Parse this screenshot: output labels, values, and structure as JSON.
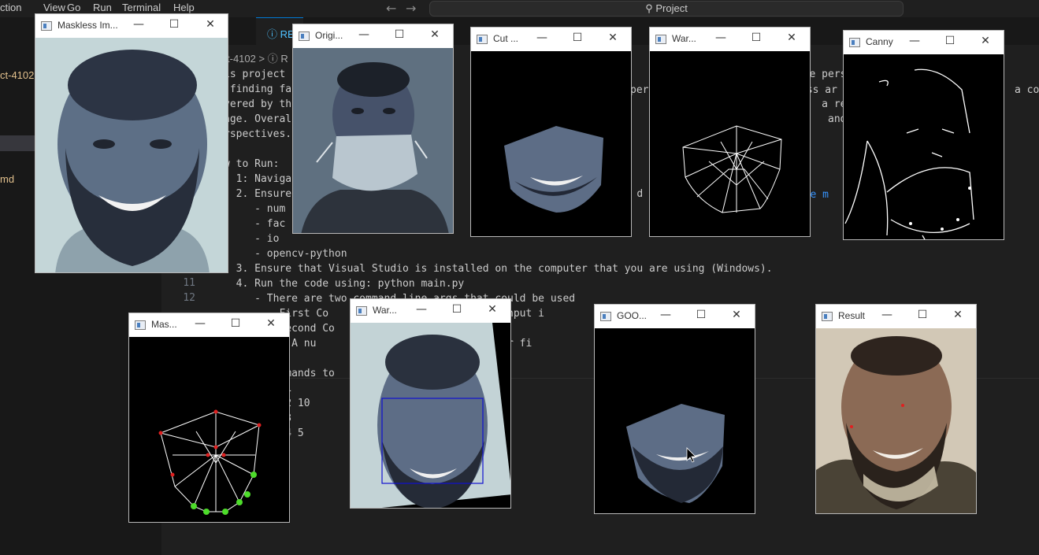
{
  "menu": [
    "ction",
    "View",
    "Go",
    "Run",
    "Terminal",
    "Help"
  ],
  "search": {
    "label": "Project"
  },
  "sidebar": {
    "items": [
      "ct-4102",
      "md"
    ]
  },
  "tab": {
    "label": "RE"
  },
  "breadcrumb": {
    "folder": "t-4102",
    "sep": ">",
    "file_start": "R"
  },
  "code_lines": [
    "is project              of                       val                    by tak                 e pers",
    " finding fa         's ",
    "vered by th         unap                     the                                 In the          a res",
    "age. Overal          to                      ever                                ld be            and w",
    "rspectives.",
    "",
    "w to Run:",
    "  1: Naviga",
    "  2. Ensure             pen                                        d (i",
    "     - num",
    "     - fac",
    "     - io",
    "     - opencv-python",
    "  3. Ensure that Visual Studio is installed on the computer that you are using (Windows).",
    "  4. Run the code using: python main.py",
    "     - There are two command line args that could be used",
    "       - First Co                    ges the input i                         s on",
    "       - Second Co",
    "         - A nu                    sholding for fi                     point (Man",
    "",
    "       commands to",
    "       py 1",
    "       py 2 10",
    "       py 3",
    "       py 4 5"
  ],
  "code_link": "kage m",
  "code_extra": "ess ar",
  "code_extra2": "a con",
  "code_extra3": "pers",
  "line_numbers": [
    "11",
    "12"
  ],
  "windows": [
    {
      "title": "Maskless Im...",
      "name": "maskless-image"
    },
    {
      "title": "Origi...",
      "name": "original-image"
    },
    {
      "title": "Cut ...",
      "name": "cut-face"
    },
    {
      "title": "War...",
      "name": "warped-mesh"
    },
    {
      "title": "Canny",
      "name": "canny"
    },
    {
      "title": "Mas...",
      "name": "mask-landmarks"
    },
    {
      "title": "War...",
      "name": "warped-face"
    },
    {
      "title": "GOO...",
      "name": "good-face"
    },
    {
      "title": "Result",
      "name": "result"
    }
  ],
  "colors": {
    "accent": "#0078d4",
    "folder": "#e2c08d",
    "link": "#3794ff"
  }
}
